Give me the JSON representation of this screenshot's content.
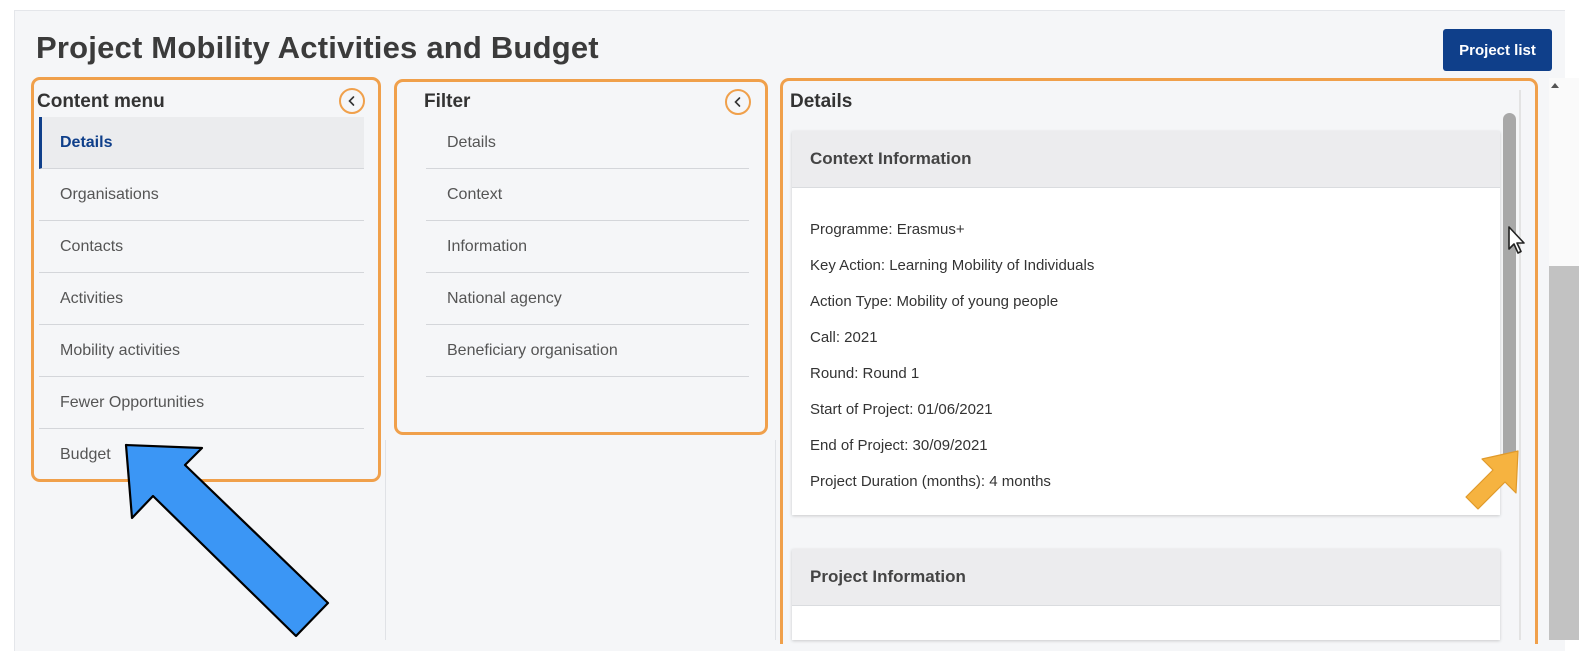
{
  "page": {
    "title": "Project Mobility Activities and Budget"
  },
  "header": {
    "project_list_label": "Project list"
  },
  "content_menu": {
    "title": "Content menu",
    "items": [
      {
        "label": "Details"
      },
      {
        "label": "Organisations"
      },
      {
        "label": "Contacts"
      },
      {
        "label": "Activities"
      },
      {
        "label": "Mobility activities"
      },
      {
        "label": "Fewer Opportunities"
      },
      {
        "label": "Budget"
      }
    ]
  },
  "filter": {
    "title": "Filter",
    "items": [
      {
        "label": "Details"
      },
      {
        "label": "Context"
      },
      {
        "label": "Information"
      },
      {
        "label": "National agency"
      },
      {
        "label": "Beneficiary organisation"
      }
    ]
  },
  "details": {
    "title": "Details",
    "context_card": {
      "title": "Context Information",
      "lines": [
        "Programme: Erasmus+",
        "Key Action: Learning Mobility of Individuals",
        "Action Type: Mobility of young people",
        "Call: 2021",
        "Round: Round 1",
        "Start of Project: 01/06/2021",
        "End of Project: 30/09/2021",
        "Project Duration (months): 4 months"
      ]
    },
    "project_card": {
      "title": "Project Information"
    }
  },
  "colors": {
    "highlight": "#f0a04b",
    "primary": "#0f3f8a",
    "arrow_blue": "#3b96f5",
    "arrow_orange": "#f6b340"
  }
}
